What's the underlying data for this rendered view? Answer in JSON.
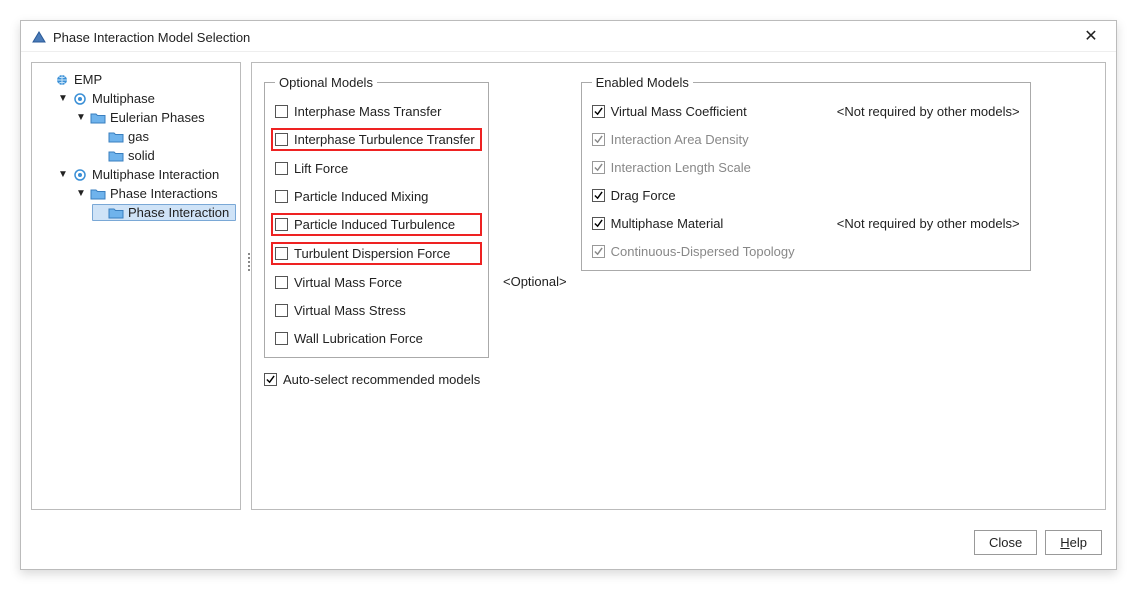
{
  "window": {
    "title": "Phase Interaction Model Selection"
  },
  "tree": {
    "root": {
      "label": "EMP",
      "multiphase": {
        "label": "Multiphase",
        "eulerian": {
          "label": "Eulerian Phases",
          "gas": "gas",
          "solid": "solid"
        }
      },
      "multiphaseInteraction": {
        "label": "Multiphase Interaction",
        "phaseInteractions": {
          "label": "Phase Interactions",
          "item": "Phase Interaction"
        }
      }
    }
  },
  "optional": {
    "legend": "Optional Models",
    "items": {
      "0": "Interphase Mass Transfer",
      "1": "Interphase Turbulence Transfer",
      "2": "Lift Force",
      "3": "Particle Induced Mixing",
      "4": "Particle Induced Turbulence",
      "5": "Turbulent Dispersion Force",
      "6": "Virtual Mass Force",
      "7": "Virtual Mass Stress",
      "8": "Wall Lubrication Force"
    }
  },
  "centerLabel": "<Optional>",
  "enabled": {
    "legend": "Enabled Models",
    "items": {
      "0": {
        "label": "Virtual Mass Coefficient",
        "note": "<Not required by other models>"
      },
      "1": {
        "label": "Interaction Area Density"
      },
      "2": {
        "label": "Interaction Length Scale"
      },
      "3": {
        "label": "Drag Force"
      },
      "4": {
        "label": "Multiphase Material",
        "note": "<Not required by other models>"
      },
      "5": {
        "label": "Continuous-Dispersed Topology"
      }
    }
  },
  "autoSelect": "Auto-select recommended models",
  "footer": {
    "close": "Close",
    "help_prefix": "H",
    "help_suffix": "elp"
  }
}
